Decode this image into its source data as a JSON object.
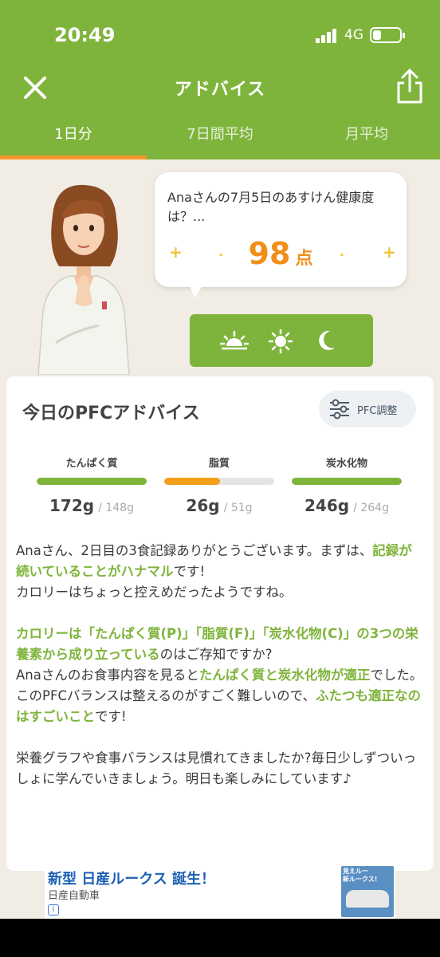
{
  "status": {
    "time": "20:49",
    "network": "4G"
  },
  "nav": {
    "title": "アドバイス",
    "close_icon": "close-icon",
    "share_icon": "share-icon"
  },
  "tabs": [
    {
      "label": "1日分",
      "active": true
    },
    {
      "label": "7日間平均",
      "active": false
    },
    {
      "label": "月平均",
      "active": false
    }
  ],
  "bubble": {
    "text": "Anaさんの7月5日のあすけん健康度は？...",
    "score": "98",
    "unit": "点"
  },
  "meal_icons": [
    "sunrise-icon",
    "sun-icon",
    "moon-icon"
  ],
  "card": {
    "title": "今日のPFCアドバイス",
    "pfc_button": "PFC調整",
    "nutrients": [
      {
        "name": "たんぱく質",
        "value": "172g",
        "target": "/ 148g",
        "ratio": 1.0,
        "color": "#7fb43c"
      },
      {
        "name": "脂質",
        "value": "26g",
        "target": "/ 51g",
        "ratio": 0.51,
        "color": "#f2a01a"
      },
      {
        "name": "炭水化物",
        "value": "246g",
        "target": "/ 264g",
        "ratio": 1.0,
        "color": "#7fb43c"
      }
    ],
    "advice": {
      "p1": [
        {
          "t": "Anaさん、2日目の3食記録ありがとうございます。まずは、",
          "g": false
        },
        {
          "t": "記録が続いていることがハナマル",
          "g": true
        },
        {
          "t": "です!\nカロリーはちょっと控えめだったようですね。",
          "g": false
        }
      ],
      "p2": [
        {
          "t": "カロリーは「たんぱく質(P)」「脂質(F)」「炭水化物(C)」の3つの栄養素から成り立っている",
          "g": true
        },
        {
          "t": "のはご存知ですか?\nAnaさんのお食事内容を見ると",
          "g": false
        },
        {
          "t": "たんぱく質と炭水化物が適正",
          "g": true
        },
        {
          "t": "でした。\nこのPFCバランスは整えるのがすごく難しいので、",
          "g": false
        },
        {
          "t": "ふたつも適正なのはすごいこと",
          "g": true
        },
        {
          "t": "です!",
          "g": false
        }
      ],
      "p3": [
        {
          "t": "栄養グラフや食事バランスは見慣れてきましたか?毎日少しずついっしょに学んでいきましょう。明日も楽しみにしています♪",
          "g": false
        }
      ]
    }
  },
  "ad": {
    "title": "新型 日産ルークス 誕生！",
    "advertiser": "日産自動車",
    "info": "i",
    "image_text": "見えルー\n新ルークス!"
  }
}
